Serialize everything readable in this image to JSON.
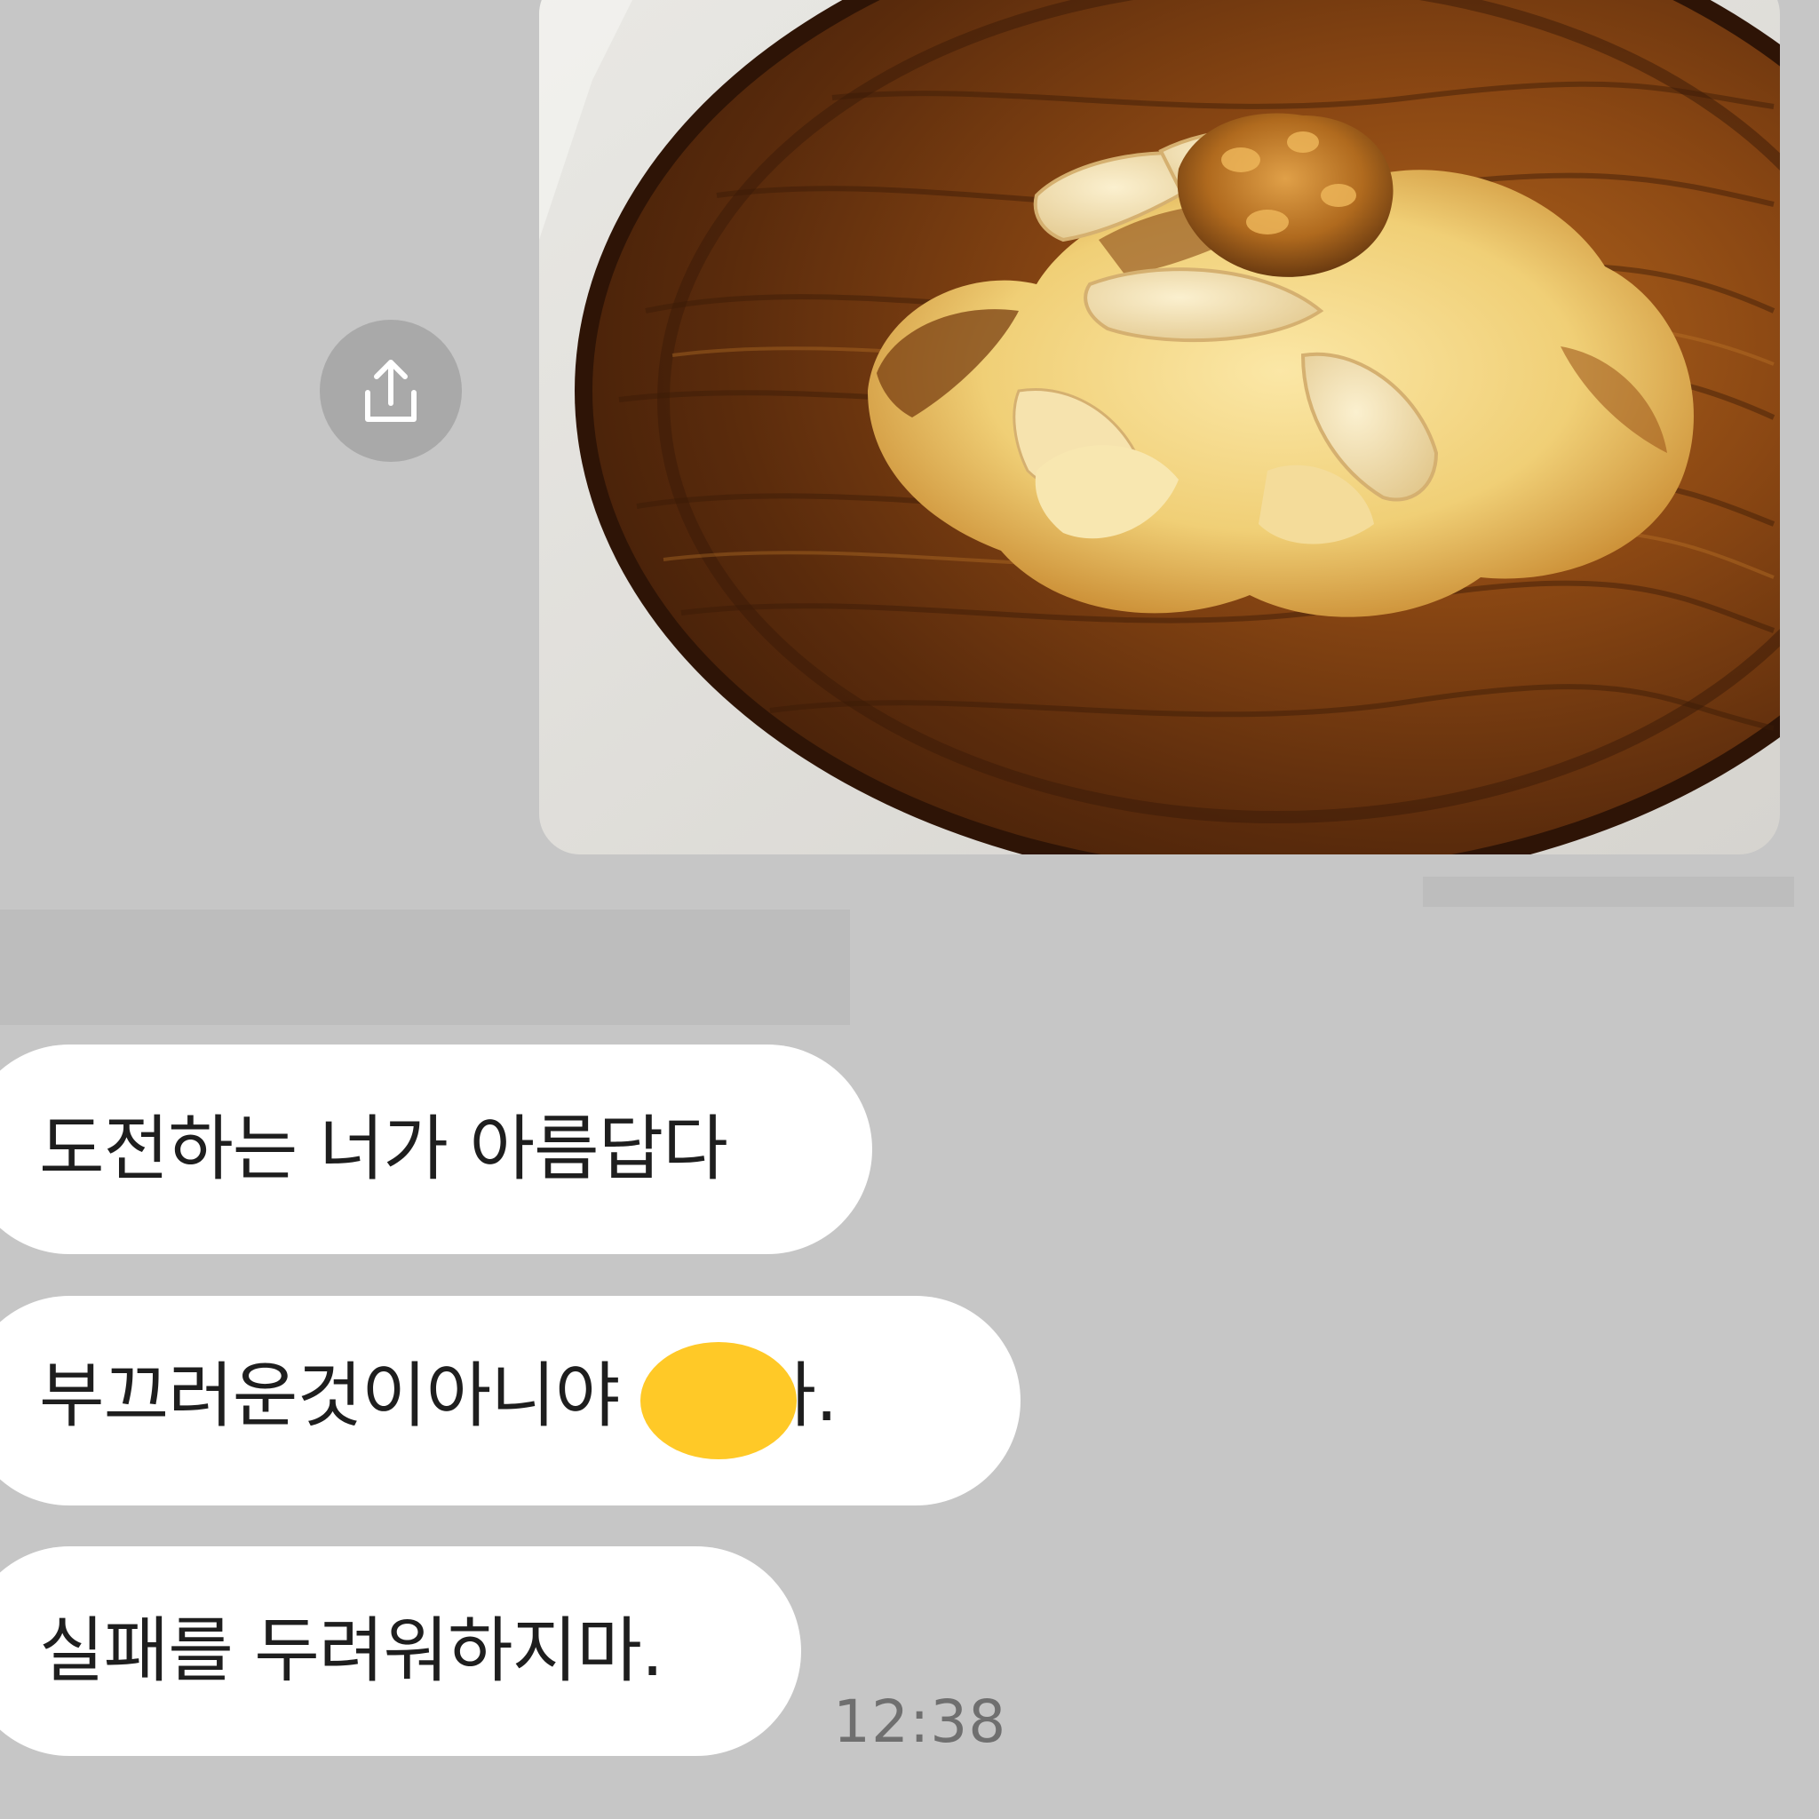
{
  "photo_message": {
    "photo_description": "pancake with apple slices and apple compote on a round wooden plate",
    "share_button_icon": "share-icon"
  },
  "messages": [
    {
      "text": "도전하는 너가 아름답다"
    },
    {
      "text_before_mask": "부끄러운것이아니야",
      "text_after_mask": "아."
    },
    {
      "text": "실패를 두려워하지마."
    }
  ],
  "timestamp": "12:38",
  "colors": {
    "background": "#c6c6c6",
    "bubble": "#ffffff",
    "name_mask": "#ffc927",
    "share_button": "#a9a9a9"
  }
}
